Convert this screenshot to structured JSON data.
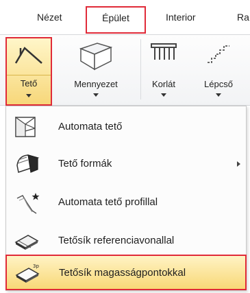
{
  "tabs": {
    "view": "Nézet",
    "building": "Épület",
    "interior": "Interior",
    "ra": "Ra"
  },
  "ribbon": {
    "roof": "Tető",
    "ceiling": "Mennyezet",
    "railing": "Korlát",
    "stairs": "Lépcső"
  },
  "menu": {
    "items": [
      {
        "label": "Automata tető",
        "icon": "auto-roof-icon"
      },
      {
        "label": "Tető formák",
        "icon": "roof-shapes-icon",
        "submenu": true
      },
      {
        "label": "Automata tető profillal",
        "icon": "roof-profile-icon"
      },
      {
        "label": "Tetősík referenciavonallal",
        "icon": "roof-plane-refline-icon"
      },
      {
        "label": "Tetősík magasságpontokkal",
        "icon": "roof-plane-heightpoints-icon",
        "highlighted": true
      }
    ]
  },
  "colors": {
    "highlight_border": "#e02a38",
    "hover_fill": "#f8d877"
  }
}
